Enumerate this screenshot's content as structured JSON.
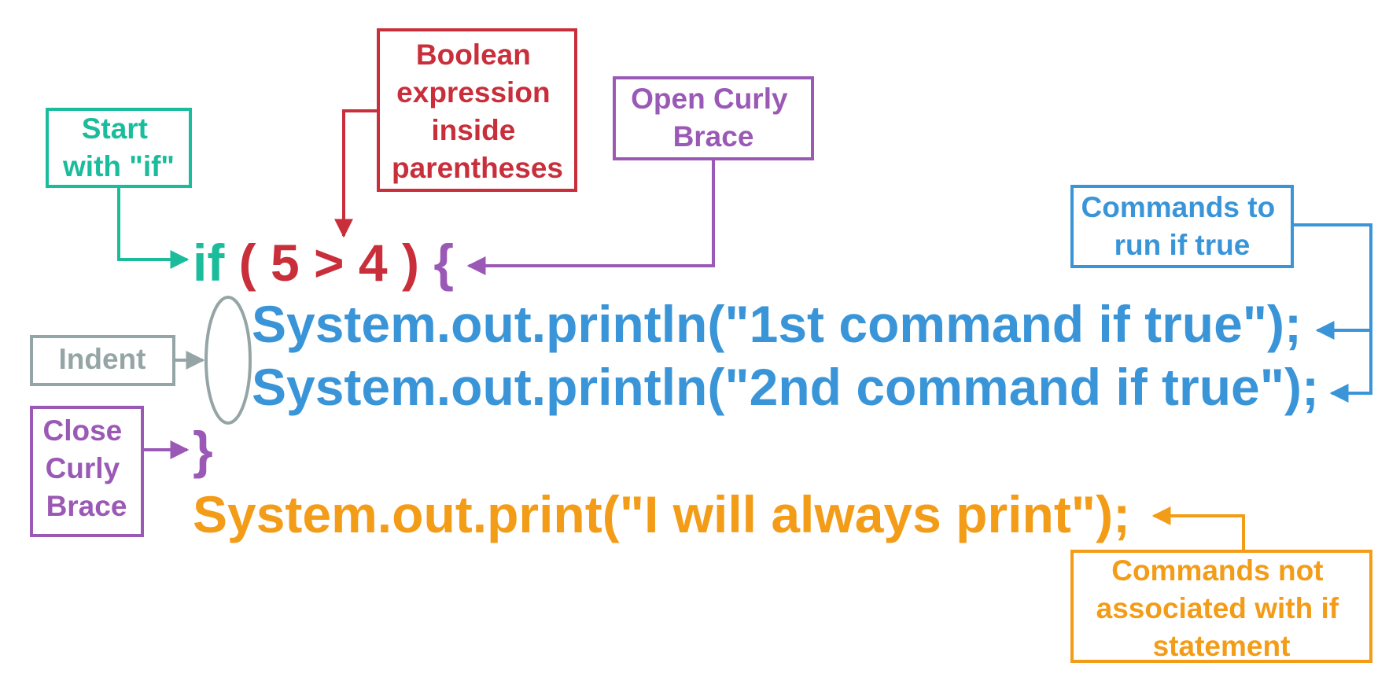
{
  "colors": {
    "teal": "#1abc9c",
    "red": "#c92e3b",
    "purple": "#9b59b6",
    "blue": "#3a95d8",
    "gray": "#95a5a6",
    "orange": "#f39c18",
    "background": "#ffffff"
  },
  "code": {
    "if_keyword": "if",
    "open_paren": "(",
    "condition": "5 > 4",
    "close_paren": ")",
    "open_brace": "{",
    "statement_1": "System.out.println(\"1st command if true\");",
    "statement_2": "System.out.println(\"2nd command if true\");",
    "close_brace": "}",
    "statement_after": "System.out.print(\"I will always print\");"
  },
  "callouts": {
    "start_if": [
      "Start",
      "with \"if\""
    ],
    "boolean_expression": [
      "Boolean",
      "expression",
      "inside",
      "parentheses"
    ],
    "open_brace": [
      "Open Curly",
      "Brace"
    ],
    "commands_true": [
      "Commands to",
      "run if true"
    ],
    "indent": [
      "Indent"
    ],
    "close_brace": [
      "Close",
      "Curly",
      "Brace"
    ],
    "not_associated": [
      "Commands not",
      "associated with if",
      "statement"
    ]
  }
}
